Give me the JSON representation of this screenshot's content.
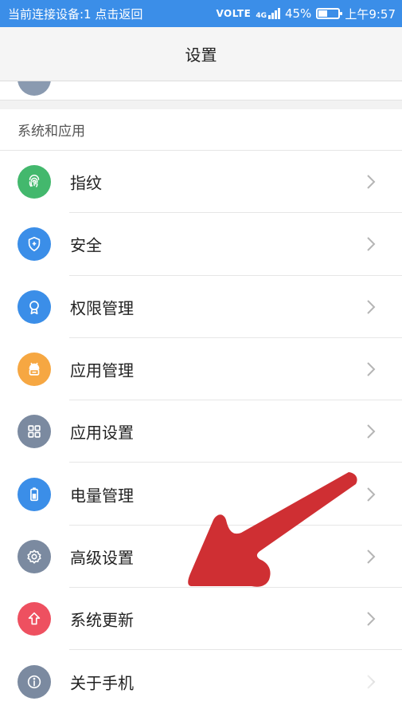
{
  "status_bar": {
    "left_text": "当前连接设备:1 点击返回",
    "volte": "VOLTE",
    "network": "4G",
    "battery_text": "45%",
    "battery_level": 0.45,
    "time": "上午9:57"
  },
  "header": {
    "title": "设置"
  },
  "section": {
    "title": "系统和应用"
  },
  "items": [
    {
      "label": "指纹",
      "icon": "fingerprint-icon",
      "color": "#43b86d"
    },
    {
      "label": "安全",
      "icon": "shield-icon",
      "color": "#3b8ee8"
    },
    {
      "label": "权限管理",
      "icon": "badge-icon",
      "color": "#3b8ee8"
    },
    {
      "label": "应用管理",
      "icon": "android-icon",
      "color": "#f6a742"
    },
    {
      "label": "应用设置",
      "icon": "grid-icon",
      "color": "#7b8aa0"
    },
    {
      "label": "电量管理",
      "icon": "battery-icon",
      "color": "#3b8ee8"
    },
    {
      "label": "高级设置",
      "icon": "gear-icon",
      "color": "#7b8aa0"
    },
    {
      "label": "系统更新",
      "icon": "upgrade-arrow-icon",
      "color": "#ee5060"
    },
    {
      "label": "关于手机",
      "icon": "info-icon",
      "color": "#7b8aa0"
    }
  ],
  "annotation": {
    "arrow_color": "#cf2f33"
  }
}
